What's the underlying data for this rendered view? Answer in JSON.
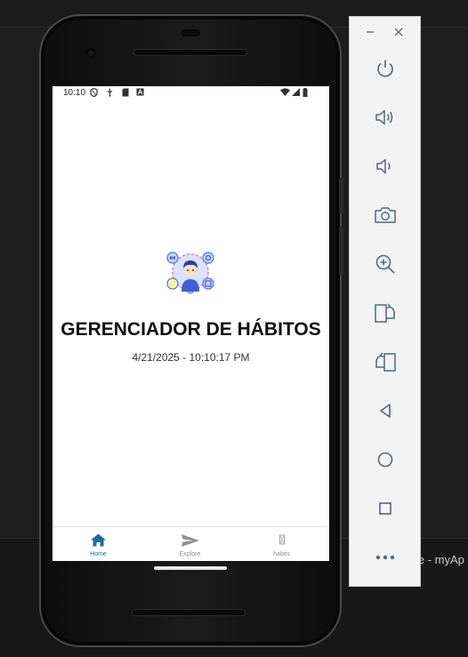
{
  "ide": {
    "bottom_text": "le - myAp"
  },
  "phone": {
    "status_bar": {
      "time": "10:10"
    },
    "app": {
      "title": "GERENCIADOR DE HÁBITOS",
      "datetime": "4/21/2025 - 10:10:17 PM"
    },
    "tabs": [
      {
        "label": "Home",
        "icon": "home-icon",
        "active": true
      },
      {
        "label": "Explore",
        "icon": "send-icon",
        "active": false
      },
      {
        "label": "habits",
        "icon": "placeholder-icon",
        "active": false
      }
    ]
  },
  "emulator_toolbar": {
    "window_buttons": [
      "minimize-icon",
      "close-icon"
    ],
    "buttons": [
      "power-icon",
      "volume-up-icon",
      "volume-down-icon",
      "camera-icon",
      "zoom-icon",
      "rotate-left-icon",
      "rotate-right-icon",
      "back-icon",
      "home-icon",
      "overview-icon",
      "more-icon"
    ]
  },
  "colors": {
    "accent": "#1a6fa5",
    "tab_inactive": "#8e8e93",
    "emulator_icon": "#4a6a86"
  }
}
